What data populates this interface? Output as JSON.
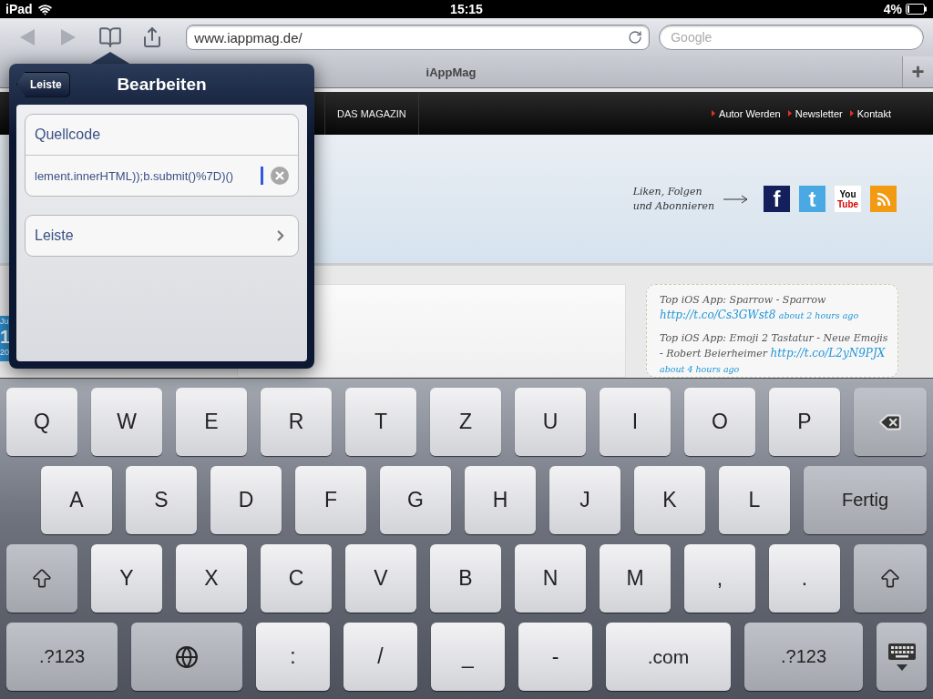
{
  "status_bar": {
    "device": "iPad",
    "time": "15:15",
    "battery": "4%"
  },
  "toolbar": {
    "url": "www.iappmag.de/",
    "search_placeholder": "Google"
  },
  "tab_bar": {
    "title": "iAppMag",
    "new_tab": "+"
  },
  "site": {
    "nav_items": [
      "DAS MAGAZIN"
    ],
    "nav_links": [
      "Autor Werden",
      "Newsletter",
      "Kontakt"
    ],
    "tagline": [
      "Liken, Folgen",
      "und Abonnieren"
    ],
    "social": [
      {
        "kind": "facebook",
        "glyph": "f"
      },
      {
        "kind": "twitter",
        "glyph": "t"
      },
      {
        "kind": "youtube",
        "lines": [
          "You",
          "Tube"
        ]
      },
      {
        "kind": "rss"
      }
    ],
    "date_badge": [
      "Ju",
      "1",
      "20"
    ],
    "tweets": [
      {
        "text": "Top iOS App: Sparrow - Sparrow",
        "link": "http://t.co/Cs3GWst8",
        "time": "about 2 hours ago"
      },
      {
        "text": "Top iOS App: Emoji 2 Tastatur - Neue Emojis - Robert Beierheimer",
        "link": "http://t.co/L2yN9PJX",
        "time": "about 4 hours ago"
      }
    ]
  },
  "popover": {
    "back": "Leiste",
    "title": "Bearbeiten",
    "name_value": "Quellcode",
    "code_value": "lement.innerHTML));b.submit()%7D)()",
    "rows": [
      "Leiste"
    ]
  },
  "keyboard": {
    "key_rows": [
      [
        {
          "kind": "char",
          "label": "Q"
        },
        {
          "kind": "char",
          "label": "W"
        },
        {
          "kind": "char",
          "label": "E"
        },
        {
          "kind": "char",
          "label": "R"
        },
        {
          "kind": "char",
          "label": "T"
        },
        {
          "kind": "char",
          "label": "Z"
        },
        {
          "kind": "char",
          "label": "U"
        },
        {
          "kind": "char",
          "label": "I"
        },
        {
          "kind": "char",
          "label": "O"
        },
        {
          "kind": "char",
          "label": "P"
        },
        {
          "kind": "backspace"
        }
      ],
      [
        {
          "kind": "char",
          "label": "A"
        },
        {
          "kind": "char",
          "label": "S"
        },
        {
          "kind": "char",
          "label": "D"
        },
        {
          "kind": "char",
          "label": "F"
        },
        {
          "kind": "char",
          "label": "G"
        },
        {
          "kind": "char",
          "label": "H"
        },
        {
          "kind": "char",
          "label": "J"
        },
        {
          "kind": "char",
          "label": "K"
        },
        {
          "kind": "char",
          "label": "L"
        },
        {
          "kind": "return",
          "label": "Fertig"
        }
      ],
      [
        {
          "kind": "shift"
        },
        {
          "kind": "char",
          "label": "Y"
        },
        {
          "kind": "char",
          "label": "X"
        },
        {
          "kind": "char",
          "label": "C"
        },
        {
          "kind": "char",
          "label": "V"
        },
        {
          "kind": "char",
          "label": "B"
        },
        {
          "kind": "char",
          "label": "N"
        },
        {
          "kind": "char",
          "label": "M"
        },
        {
          "kind": "char",
          "label": ","
        },
        {
          "kind": "char",
          "label": "."
        },
        {
          "kind": "shift"
        }
      ],
      [
        {
          "kind": "mode",
          "label": ".?123"
        },
        {
          "kind": "globe"
        },
        {
          "kind": "char",
          "label": ":"
        },
        {
          "kind": "char",
          "label": "/"
        },
        {
          "kind": "char",
          "label": "_"
        },
        {
          "kind": "char",
          "label": "-"
        },
        {
          "kind": "wide",
          "label": ".com"
        },
        {
          "kind": "mode",
          "label": ".?123"
        },
        {
          "kind": "dismiss"
        }
      ]
    ]
  }
}
